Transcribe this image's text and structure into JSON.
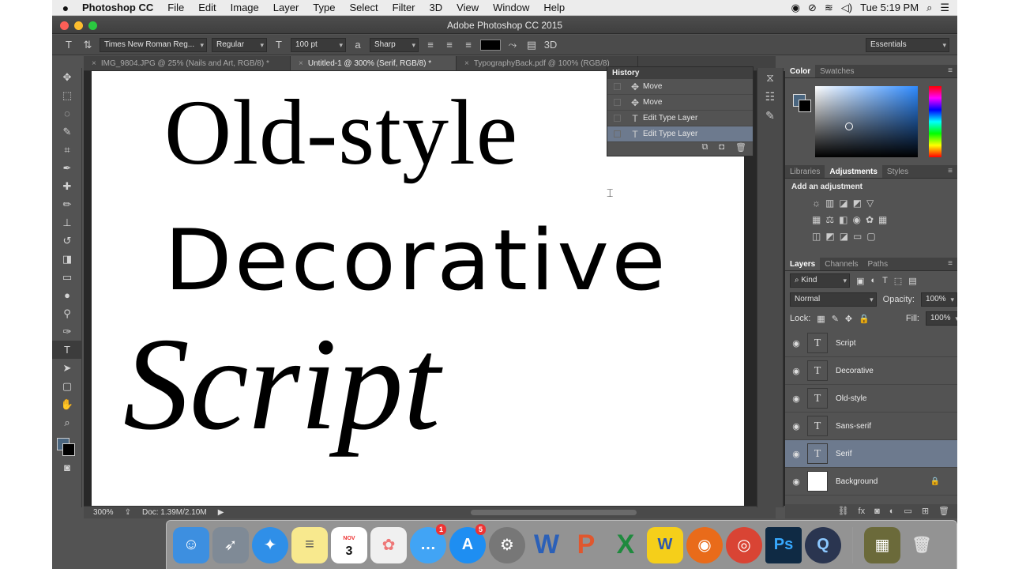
{
  "menubar": {
    "app": "Photoshop CC",
    "items": [
      "File",
      "Edit",
      "Image",
      "Layer",
      "Type",
      "Select",
      "Filter",
      "3D",
      "View",
      "Window",
      "Help"
    ],
    "clock": "Tue 5:19 PM"
  },
  "window": {
    "title": "Adobe Photoshop CC 2015"
  },
  "options": {
    "font_family": "Times New Roman Reg...",
    "font_style": "Regular",
    "font_size": "100 pt",
    "antialias": "Sharp",
    "workspace": "Essentials",
    "color_swatch": "#000000"
  },
  "tabs": [
    {
      "label": "IMG_9804.JPG @ 25% (Nails and Art, RGB/8) *"
    },
    {
      "label": "Untitled-1 @ 300% (Serif, RGB/8) *"
    },
    {
      "label": "TypographyBack.pdf @ 100% (RGB/8)"
    }
  ],
  "canvas": {
    "words": [
      "Old-style",
      "Decorative",
      "Script"
    ]
  },
  "status": {
    "zoom": "300%",
    "doc": "Doc: 1.39M/2.10M"
  },
  "history": {
    "title": "History",
    "items": [
      {
        "label": "Move"
      },
      {
        "label": "Move"
      },
      {
        "label": "Edit Type Layer"
      },
      {
        "label": "Edit Type Layer"
      }
    ]
  },
  "color_panel": {
    "tabs": [
      "Color",
      "Swatches"
    ],
    "fg": "#4a6680",
    "bg": "#000000"
  },
  "adjust_panel": {
    "tabs": [
      "Libraries",
      "Adjustments",
      "Styles"
    ],
    "label": "Add an adjustment"
  },
  "layers_panel": {
    "tabs": [
      "Layers",
      "Channels",
      "Paths"
    ],
    "filter": "Kind",
    "blend": "Normal",
    "opacity_label": "Opacity:",
    "opacity": "100%",
    "lock_label": "Lock:",
    "fill_label": "Fill:",
    "fill": "100%",
    "layers": [
      {
        "name": "Script",
        "type": "T"
      },
      {
        "name": "Decorative",
        "type": "T"
      },
      {
        "name": "Old-style",
        "type": "T"
      },
      {
        "name": "Sans-serif",
        "type": "T"
      },
      {
        "name": "Serif",
        "type": "T"
      },
      {
        "name": "Background",
        "type": ""
      }
    ]
  },
  "dock": {
    "calendar_month": "NOV",
    "calendar_day": "3",
    "badges": {
      "messages": "1",
      "appstore": "5"
    }
  }
}
